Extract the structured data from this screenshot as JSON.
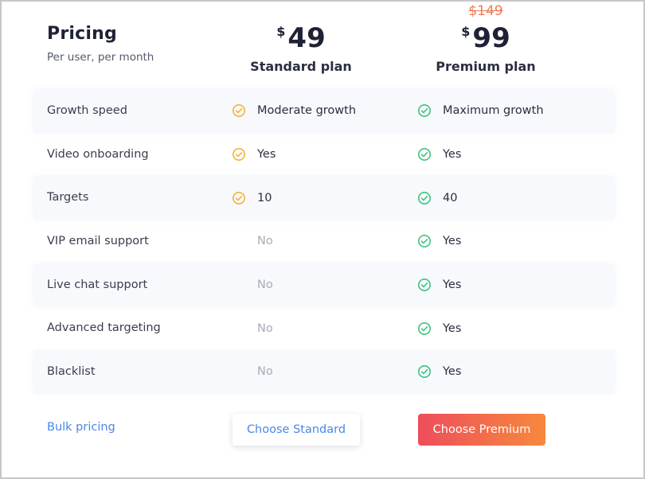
{
  "header": {
    "title": "Pricing",
    "subtitle": "Per user, per month"
  },
  "plans": {
    "standard": {
      "currency": "$",
      "price": "49",
      "name": "Standard plan"
    },
    "premium": {
      "currency": "$",
      "old_price": "$149",
      "price": "99",
      "name": "Premium plan"
    }
  },
  "colors": {
    "standard_check": "#f5b335",
    "premium_check": "#3dc47e",
    "link": "#4a86e8",
    "old_price": "#f07a52"
  },
  "features": [
    {
      "name": "Growth speed",
      "standard": "Moderate growth",
      "standard_included": true,
      "premium": "Maximum growth",
      "premium_included": true
    },
    {
      "name": "Video onboarding",
      "standard": "Yes",
      "standard_included": true,
      "premium": "Yes",
      "premium_included": true
    },
    {
      "name": "Targets",
      "standard": "10",
      "standard_included": true,
      "premium": "40",
      "premium_included": true
    },
    {
      "name": "VIP email support",
      "standard": "No",
      "standard_included": false,
      "premium": "Yes",
      "premium_included": true
    },
    {
      "name": "Live chat support",
      "standard": "No",
      "standard_included": false,
      "premium": "Yes",
      "premium_included": true
    },
    {
      "name": "Advanced targeting",
      "standard": "No",
      "standard_included": false,
      "premium": "Yes",
      "premium_included": true
    },
    {
      "name": "Blacklist",
      "standard": "No",
      "standard_included": false,
      "premium": "Yes",
      "premium_included": true
    }
  ],
  "footer": {
    "bulk_label": "Bulk pricing",
    "standard_button": "Choose Standard",
    "premium_button": "Choose Premium"
  }
}
